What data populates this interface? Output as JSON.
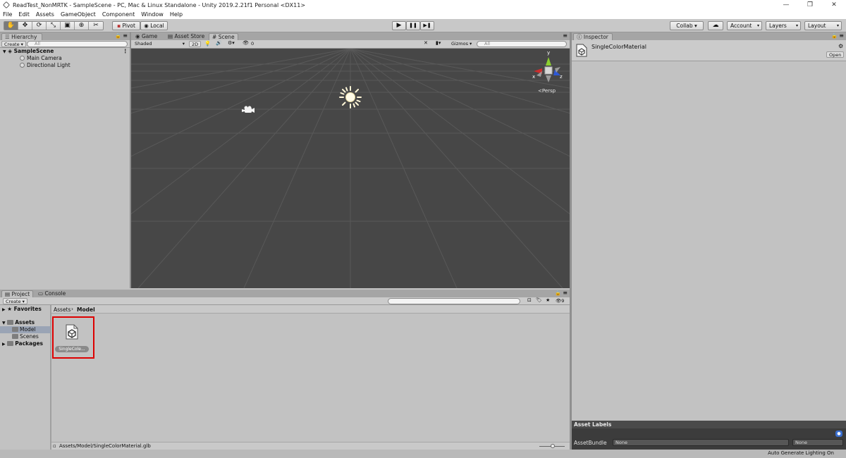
{
  "window": {
    "title": "ReadTest_NonMRTK - SampleScene - PC, Mac & Linux Standalone - Unity 2019.2.21f1 Personal <DX11>",
    "controls": [
      "—",
      "❐",
      "✕"
    ]
  },
  "menu": [
    "File",
    "Edit",
    "Assets",
    "GameObject",
    "Component",
    "Window",
    "Help"
  ],
  "toolbar": {
    "tools": [
      "✋",
      "✥",
      "⟳",
      "⤡",
      "▣",
      "⊕",
      "✂"
    ],
    "pivot": "Pivot",
    "local": "Local",
    "play": "▶",
    "pause": "❚❚",
    "step": "▶❚",
    "collab": "Collab ▾",
    "cloud": "☁",
    "account": "Account",
    "layers": "Layers",
    "layout": "Layout"
  },
  "hierarchy": {
    "tab": "Hierarchy",
    "create": "Create ▾",
    "search_placeholder": "All",
    "scene_name": "SampleScene",
    "items": [
      "Main Camera",
      "Directional Light"
    ]
  },
  "scene_tabs": {
    "game": "Game",
    "asset_store": "Asset Store",
    "scene": "Scene"
  },
  "scene_toolbar": {
    "shading": "Shaded",
    "mode_2d": "2D",
    "fx_count": "0",
    "gizmos": "Gizmos ▾",
    "search_placeholder": "All"
  },
  "scene_gizmo": {
    "y": "y",
    "x": "x",
    "z": "z",
    "persp": "Persp"
  },
  "project": {
    "tabs": [
      "Project",
      "Console"
    ],
    "create": "Create ▾",
    "favorites": "Favorites",
    "assets_label": "Assets",
    "assets_children": [
      "Model",
      "Scenes"
    ],
    "packages": "Packages",
    "breadcrumb": [
      "Assets",
      "Model"
    ],
    "filter_count": "9",
    "asset_item_label": "SingleCole...",
    "path": "Assets/Model/SingleColorMaterial.glb"
  },
  "inspector": {
    "tab": "Inspector",
    "object_name": "SingleColorMaterial",
    "open_button": "Open",
    "asset_labels": "Asset Labels",
    "asset_bundle_label": "AssetBundle",
    "bundle_value": "None",
    "variant_value": "None"
  },
  "status": {
    "lighting": "Auto Generate Lighting On"
  },
  "colors": {
    "selection_highlight": "#dd0000",
    "scene_bg": "#474747"
  }
}
